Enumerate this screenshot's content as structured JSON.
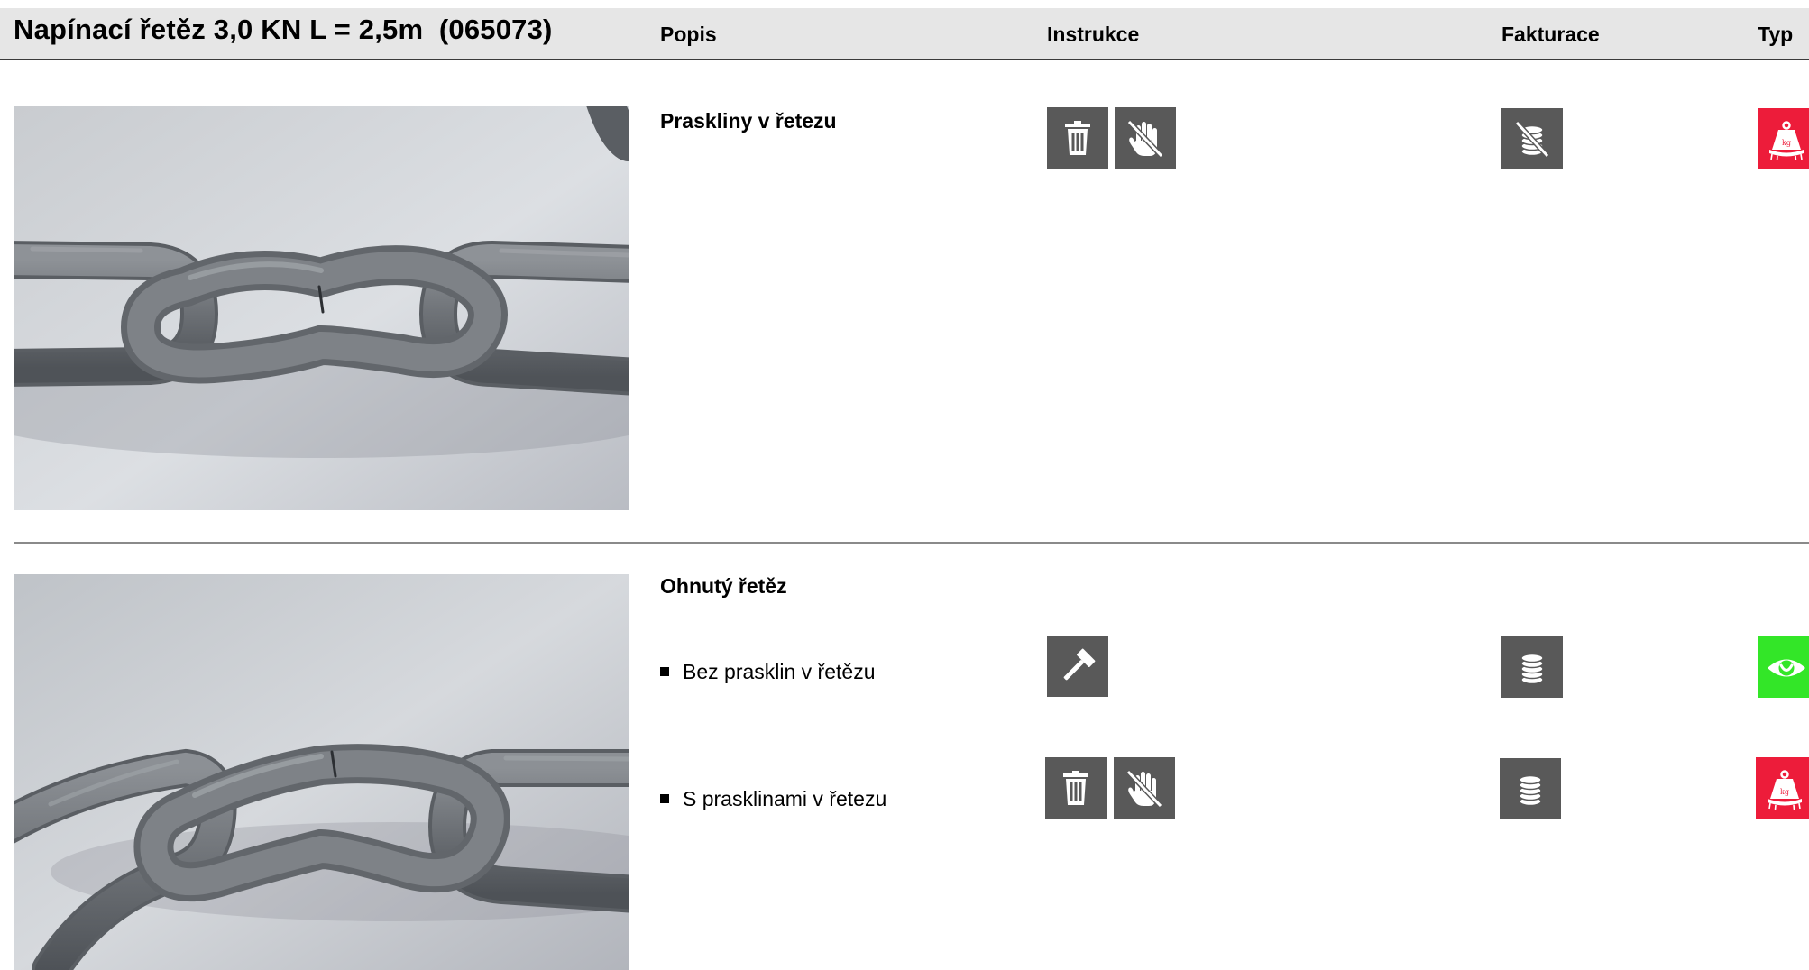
{
  "header": {
    "title": "Napínací řetěz 3,0 KN L = 2,5m  (065073)",
    "columns": {
      "popis": "Popis",
      "instrukce": "Instrukce",
      "fakturace": "Fakturace",
      "typ": "Typ"
    }
  },
  "sections": [
    {
      "title": "Praskliny v řetezu",
      "photo": "cracked-chain-photo",
      "instruction_icons": [
        "trash-icon",
        "no-touch-hand-icon"
      ],
      "billing_icon": "no-coins-icon",
      "type_icon": "weight-kg-icon",
      "type_color": "#ed1c3a"
    },
    {
      "title": "Ohnutý řetěz",
      "photo": "bent-chain-photo",
      "items": [
        {
          "label": "Bez prasklin v řetězu",
          "instruction_icons": [
            "hammer-icon"
          ],
          "billing_icon": "coins-icon",
          "type_icon": "eye-icon",
          "type_color": "#33e628"
        },
        {
          "label": "S prasklinami v řetezu",
          "instruction_icons": [
            "trash-icon",
            "no-touch-hand-icon"
          ],
          "billing_icon": "coins-icon",
          "type_icon": "weight-kg-icon",
          "type_color": "#ed1c3a"
        }
      ]
    }
  ],
  "colors": {
    "header_bg": "#e6e6e6",
    "icon_gray": "#595959",
    "scrap_red": "#ed1c3a",
    "ok_green": "#33e628"
  }
}
